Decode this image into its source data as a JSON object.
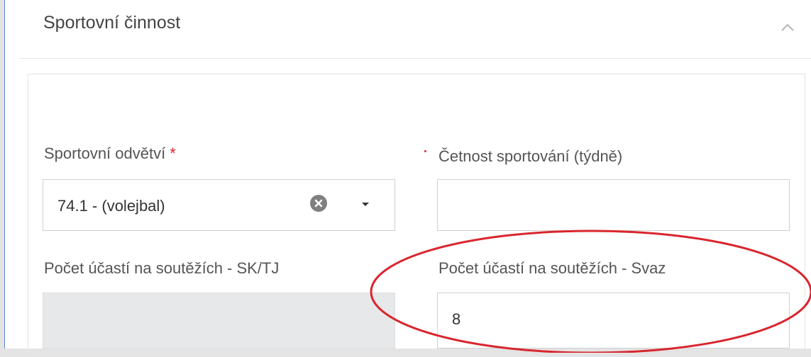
{
  "section": {
    "title": "Sportovní činnost"
  },
  "fields": {
    "sport_branch": {
      "label": "Sportovní odvětví",
      "required_mark": "*",
      "value": "74.1 - (volejbal)"
    },
    "frequency": {
      "label": "Četnost sportování (týdně)",
      "value": ""
    },
    "competitions_club": {
      "label": "Počet účastí na soutěžích - SK/TJ",
      "value": ""
    },
    "competitions_federation": {
      "label": "Počet účastí na soutěžích - Svaz",
      "value": "8"
    }
  },
  "icons": {
    "collapse": "chevron-up-icon",
    "clear": "clear-circle-icon",
    "dropdown": "caret-down-icon"
  },
  "colors": {
    "panel_border": "#5b86c9",
    "required": "#d9262e",
    "annotation": "#d9262e",
    "disabled_bg": "#e7e8ea"
  }
}
